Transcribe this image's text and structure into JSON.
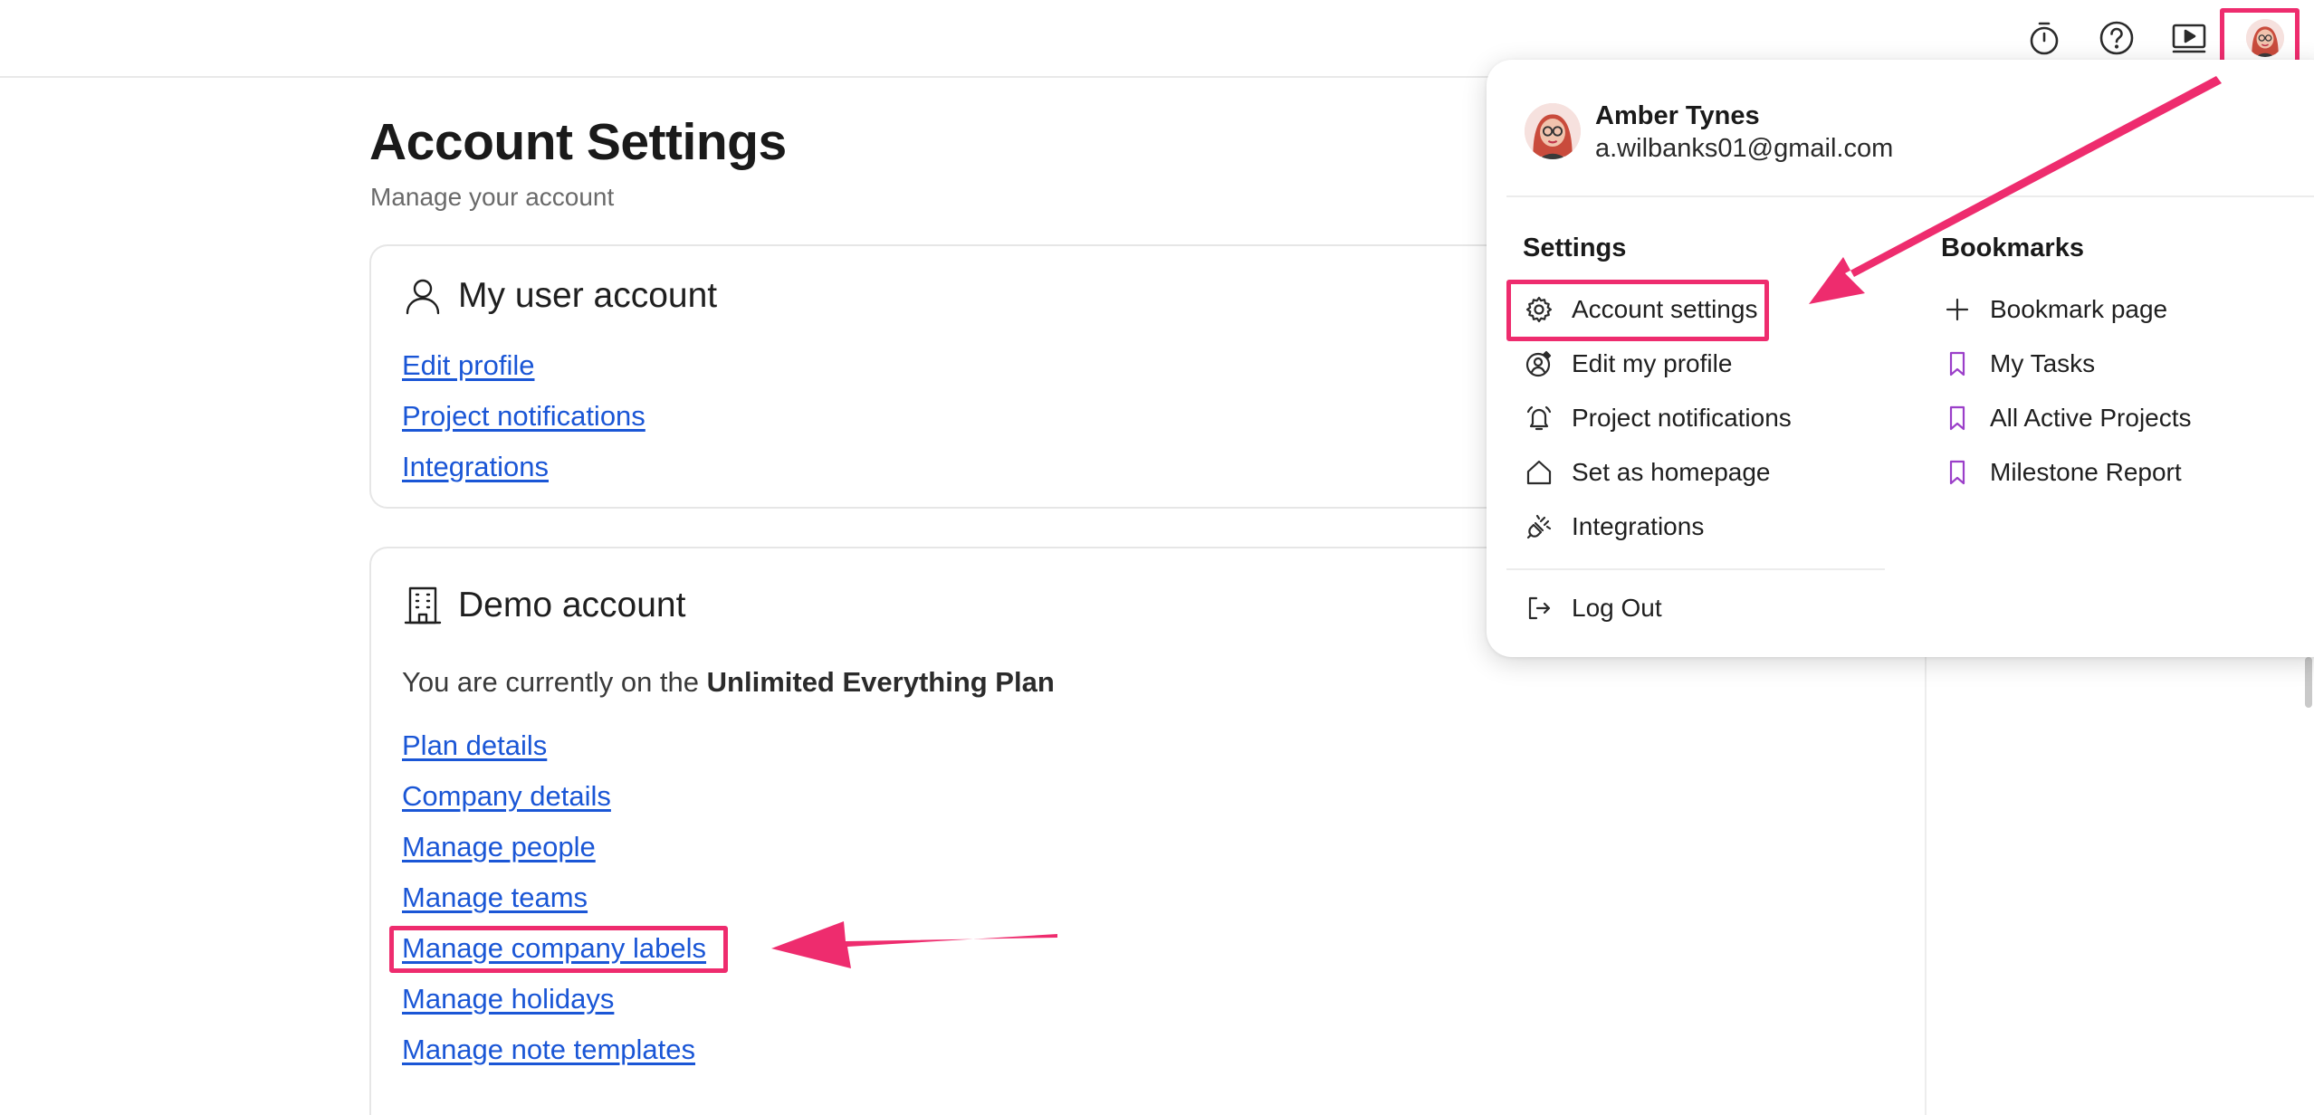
{
  "topbar": {
    "icons": [
      "stopwatch-icon",
      "help-icon",
      "video-icon",
      "avatar"
    ]
  },
  "page": {
    "title": "Account Settings",
    "subtitle": "Manage your account"
  },
  "user_card": {
    "title": "My user account",
    "links": [
      "Edit profile",
      "Project notifications",
      "Integrations"
    ]
  },
  "demo_card": {
    "title": "Demo account",
    "plan_prefix": "You are currently on the ",
    "plan_name": "Unlimited Everything Plan",
    "links": [
      "Plan details",
      "Company details",
      "Manage people",
      "Manage teams",
      "Manage company labels",
      "Manage holidays",
      "Manage note templates"
    ]
  },
  "dropdown": {
    "user": {
      "name": "Amber Tynes",
      "email": "a.wilbanks01@gmail.com"
    },
    "settings_title": "Settings",
    "settings_items": [
      "Account settings",
      "Edit my profile",
      "Project notifications",
      "Set as homepage",
      "Integrations"
    ],
    "logout": "Log Out",
    "bookmarks_title": "Bookmarks",
    "bookmark_items": [
      "Bookmark page",
      "My Tasks",
      "All Active Projects",
      "Milestone Report"
    ]
  },
  "colors": {
    "link": "#1a56d6",
    "annotation": "#ee2c6e",
    "bookmark": "#9b3fc9"
  }
}
